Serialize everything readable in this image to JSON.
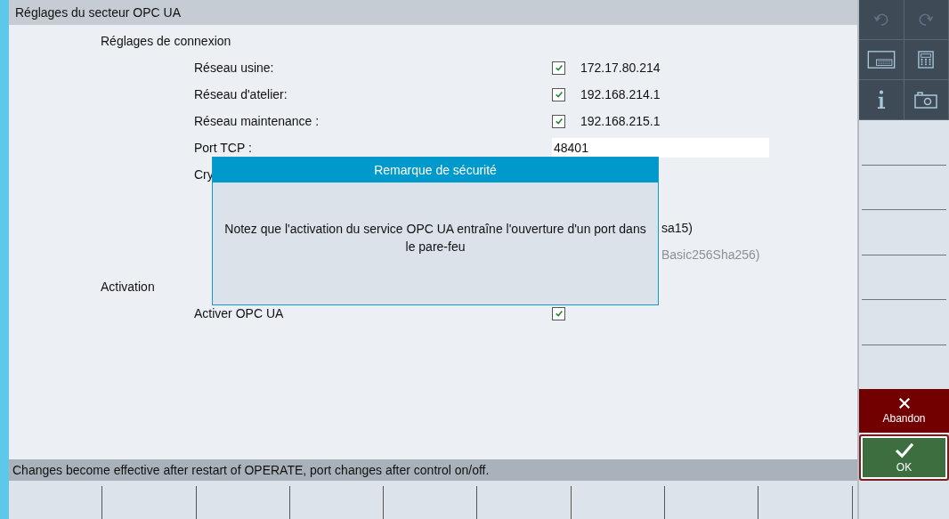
{
  "window": {
    "title": "Réglages du secteur OPC UA"
  },
  "sections": [
    {
      "title": "Réglages de connexion",
      "rows": [
        {
          "kind": "checkbox-value",
          "label": "Réseau usine:",
          "checked": true,
          "value": "172.17.80.214"
        },
        {
          "kind": "checkbox-value",
          "label": "Réseau d'atelier:",
          "checked": true,
          "value": "192.168.214.1"
        },
        {
          "kind": "checkbox-value",
          "label": "Réseau maintenance :",
          "checked": true,
          "value": "192.168.215.1"
        },
        {
          "kind": "input",
          "label": "Port TCP :",
          "value": "48401"
        },
        {
          "kind": "options",
          "label": "Cry",
          "options": [
            {
              "text": "sa15)",
              "disabled": false
            },
            {
              "text": "Basic256Sha256)",
              "disabled": true
            }
          ]
        }
      ]
    },
    {
      "title": "Activation",
      "rows": [
        {
          "kind": "checkbox",
          "label": "Activer OPC UA",
          "checked": true
        }
      ]
    }
  ],
  "dialog": {
    "title": "Remarque de sécurité",
    "message": "Notez que l'activation du service OPC UA entraîne l'ouverture d'un port dans le pare-feu"
  },
  "status_bar": "Changes become effective after restart of OPERATE, port changes after control on/off.",
  "toolbar": [
    {
      "kind": "undo",
      "disabled": true
    },
    {
      "kind": "redo",
      "disabled": true
    },
    {
      "kind": "keyboard",
      "disabled": false
    },
    {
      "kind": "calculator",
      "disabled": false
    },
    {
      "kind": "info",
      "disabled": false
    },
    {
      "kind": "camera",
      "disabled": false
    }
  ],
  "vertical_softkeys": [
    {
      "kind": "empty"
    },
    {
      "kind": "empty"
    },
    {
      "kind": "empty"
    },
    {
      "kind": "empty"
    },
    {
      "kind": "empty"
    },
    {
      "kind": "empty"
    },
    {
      "kind": "cancel",
      "label": "Abandon",
      "selected": false
    },
    {
      "kind": "ok",
      "label": "OK",
      "selected": true
    }
  ],
  "horizontal_softkeys": [
    {
      "kind": "empty"
    },
    {
      "kind": "empty"
    },
    {
      "kind": "empty"
    },
    {
      "kind": "empty"
    },
    {
      "kind": "empty"
    },
    {
      "kind": "empty"
    },
    {
      "kind": "empty"
    },
    {
      "kind": "empty"
    },
    {
      "kind": "empty"
    }
  ]
}
